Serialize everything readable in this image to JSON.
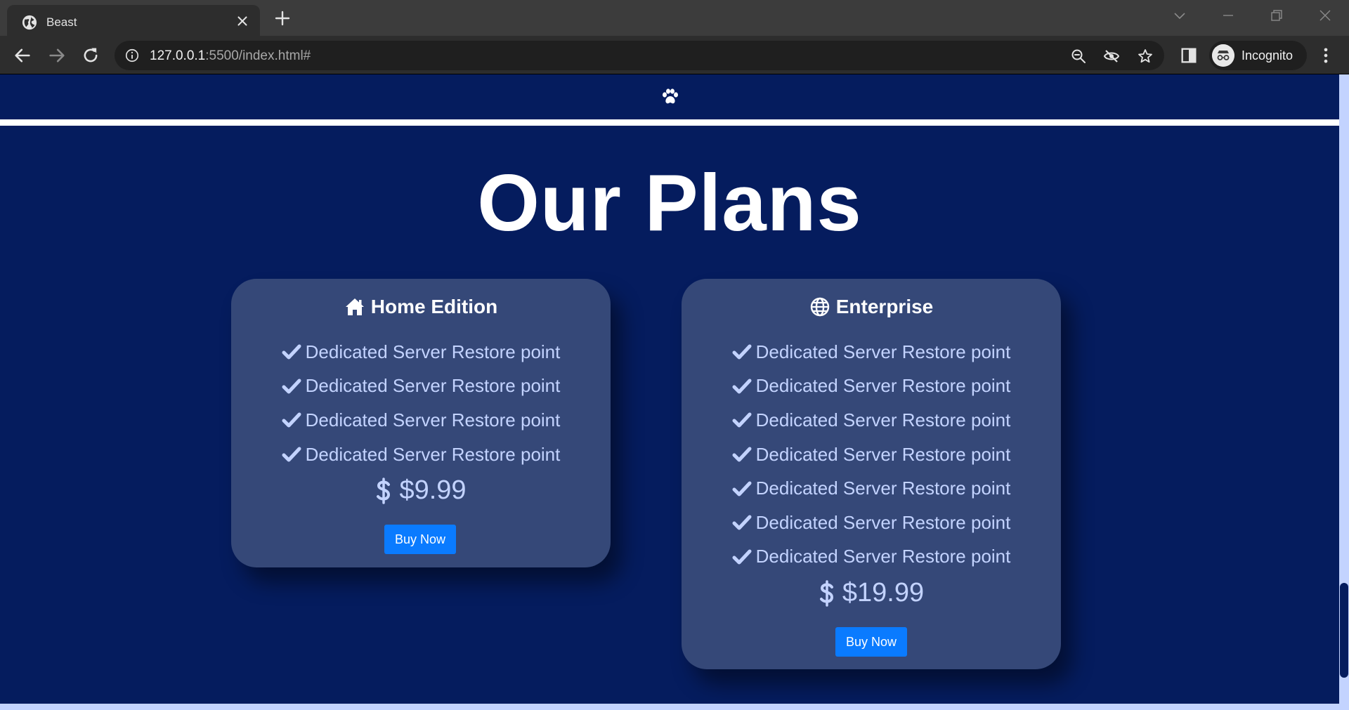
{
  "browser": {
    "tab_title": "Beast",
    "url_host": "127.0.0.1",
    "url_rest": ":5500/index.html#",
    "profile_label": "Incognito"
  },
  "page": {
    "title": "Our Plans",
    "plans": [
      {
        "name": "Home Edition",
        "icon": "home-icon",
        "features": [
          "Dedicated Server Restore point",
          "Dedicated Server Restore point",
          "Dedicated Server Restore point",
          "Dedicated Server Restore point"
        ],
        "price": "$9.99",
        "button_label": "Buy Now"
      },
      {
        "name": "Enterprise",
        "icon": "globe-icon",
        "features": [
          "Dedicated Server Restore point",
          "Dedicated Server Restore point",
          "Dedicated Server Restore point",
          "Dedicated Server Restore point",
          "Dedicated Server Restore point",
          "Dedicated Server Restore point",
          "Dedicated Server Restore point"
        ],
        "price": "$19.99",
        "button_label": "Buy Now"
      }
    ]
  },
  "colors": {
    "background": "#051c5e",
    "card": "#354878",
    "accent_text": "#c3d3ff",
    "button": "#0a7bff"
  }
}
